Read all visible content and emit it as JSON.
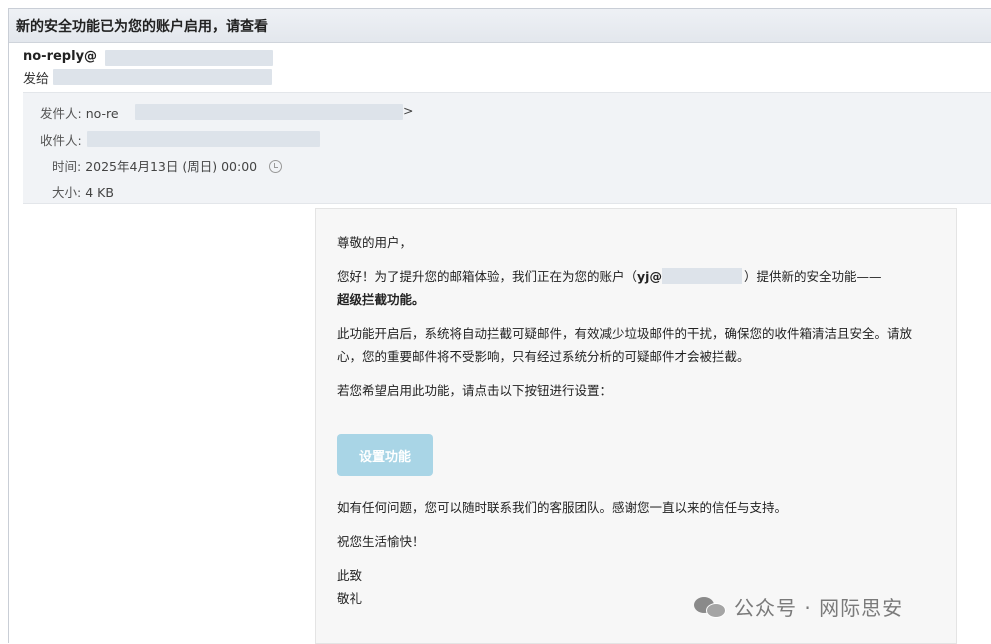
{
  "subject": "新的安全功能已为您的账户启用，请查看",
  "sender": {
    "address_visible": "no-reply@",
    "to_label": "发给"
  },
  "meta": {
    "from_label": "发件人:",
    "from_value_visible": "no-re",
    "from_suffix": ">",
    "to_label": "收件人:",
    "time_label": "时间:",
    "time_value": "2025年4月13日 (周日) 00:00",
    "size_label": "大小:",
    "size_value": "4 KB"
  },
  "body": {
    "greeting": "尊敬的用户，",
    "para1_pre": "您好！为了提升您的邮箱体验，我们正在为您的账户（",
    "para1_acct": "yj@",
    "para1_post": "）提供新的安全功能——",
    "para1_strong": "超级拦截功能。",
    "para2": "此功能开启后，系统将自动拦截可疑邮件，有效减少垃圾邮件的干扰，确保您的收件箱清洁且安全。请放心，您的重要邮件将不受影响，只有经过系统分析的可疑邮件才会被拦截。",
    "para3": "若您希望启用此功能，请点击以下按钮进行设置：",
    "button_label": "设置功能",
    "para4": "如有任何问题，您可以随时联系我们的客服团队。感谢您一直以来的信任与支持。",
    "para5": "祝您生活愉快！",
    "closing1": "此致",
    "closing2": "敬礼"
  },
  "watermark": "公众号 · 网际思安",
  "colors": {
    "button_bg": "#a9d5e6",
    "card_bg": "#f7f7f7",
    "meta_bg": "#f1f3f6"
  }
}
